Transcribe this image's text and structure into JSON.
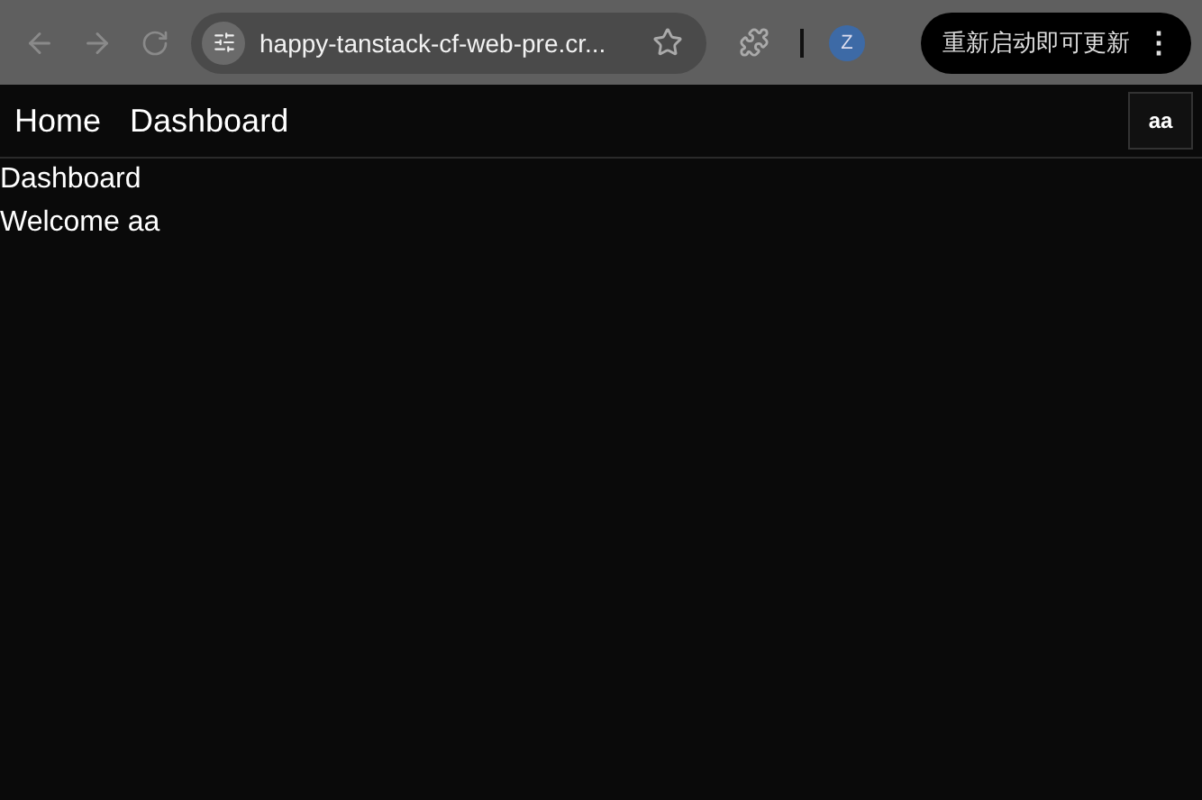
{
  "browser": {
    "url": "happy-tanstack-cf-web-pre.cr...",
    "profile_initial": "Z",
    "update_button": "重新启动即可更新",
    "menu_glyph": "⋮"
  },
  "nav": {
    "links": [
      "Home",
      "Dashboard"
    ],
    "user_button": "aa"
  },
  "content": {
    "heading": "Dashboard",
    "welcome": "Welcome aa"
  }
}
